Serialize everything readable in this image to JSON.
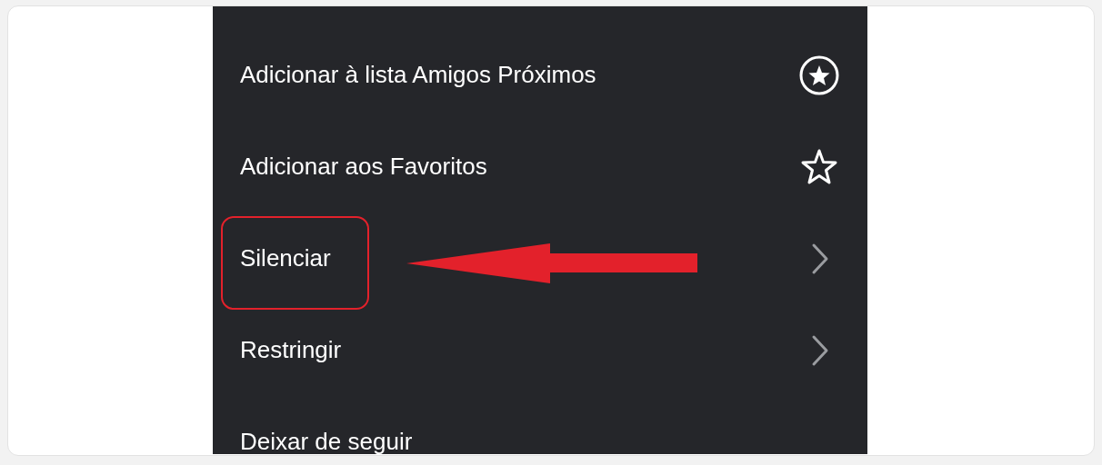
{
  "menu": {
    "items": [
      {
        "label": "Adicionar à lista Amigos Próximos",
        "kind": "star-circle",
        "highlighted": false
      },
      {
        "label": "Adicionar aos Favoritos",
        "kind": "star",
        "highlighted": false
      },
      {
        "label": "Silenciar",
        "kind": "chevron",
        "highlighted": true
      },
      {
        "label": "Restringir",
        "kind": "chevron",
        "highlighted": false
      },
      {
        "label": "Deixar de seguir",
        "kind": "plain",
        "highlighted": false
      }
    ]
  }
}
